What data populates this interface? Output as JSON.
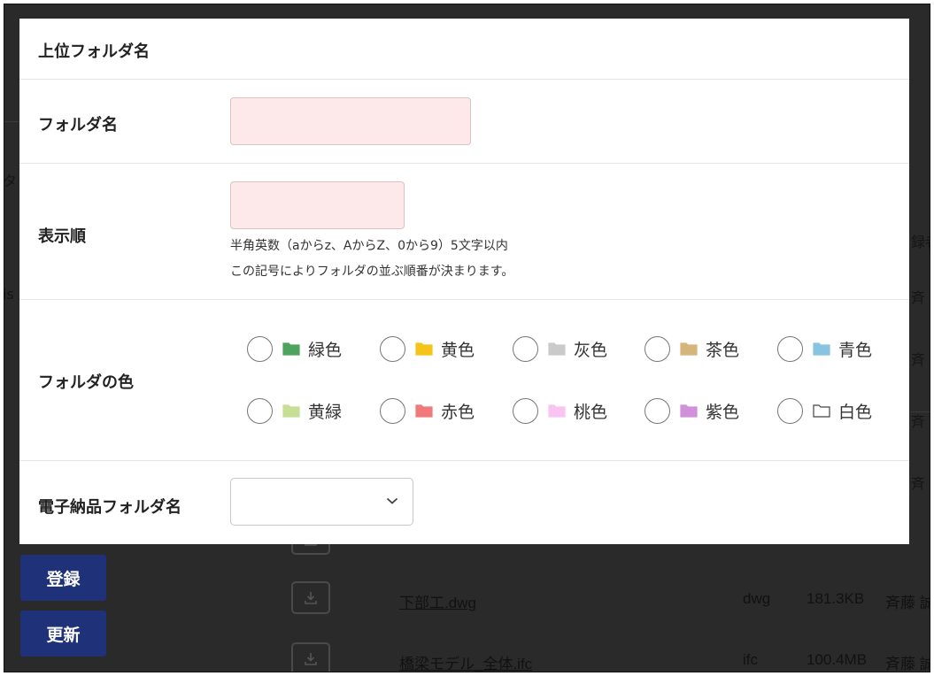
{
  "modal": {
    "parent_folder_label": "上位フォルダ名",
    "folder_name_label": "フォルダ名",
    "folder_name_value": "",
    "display_order_label": "表示順",
    "display_order_value": "",
    "display_order_hint1": "半角英数（aからz、AからZ、0から9）5文字以内",
    "display_order_hint2": "この記号によりフォルダの並ぶ順番が決まります。",
    "folder_color_label": "フォルダの色",
    "colors": [
      {
        "label": "緑色",
        "hex": "#4ea45d"
      },
      {
        "label": "黄色",
        "hex": "#f6c418"
      },
      {
        "label": "灰色",
        "hex": "#cacaca"
      },
      {
        "label": "茶色",
        "hex": "#d6b57b"
      },
      {
        "label": "青色",
        "hex": "#88c3e2"
      },
      {
        "label": "黄緑",
        "hex": "#c6df95"
      },
      {
        "label": "赤色",
        "hex": "#f07a7a"
      },
      {
        "label": "桃色",
        "hex": "#fac4f2"
      },
      {
        "label": "紫色",
        "hex": "#cf91d9"
      },
      {
        "label": "白色",
        "hex": "#ffffff"
      }
    ],
    "electronic_folder_label": "電子納品フォルダ名",
    "electronic_folder_value": ""
  },
  "background": {
    "register_button": "登録",
    "update_button": "更新",
    "files": [
      {
        "name": "下部工.dwg",
        "type": "dwg",
        "size": "181.3KB",
        "owner": "斉藤 誠"
      },
      {
        "name": "橋梁モデル_全体.ifc",
        "type": "ifc",
        "size": "100.4MB",
        "owner": "斉藤 誠"
      }
    ]
  },
  "colors": {
    "primary_button": "#1f3178",
    "input_invalid_bg": "#fde9e9"
  }
}
